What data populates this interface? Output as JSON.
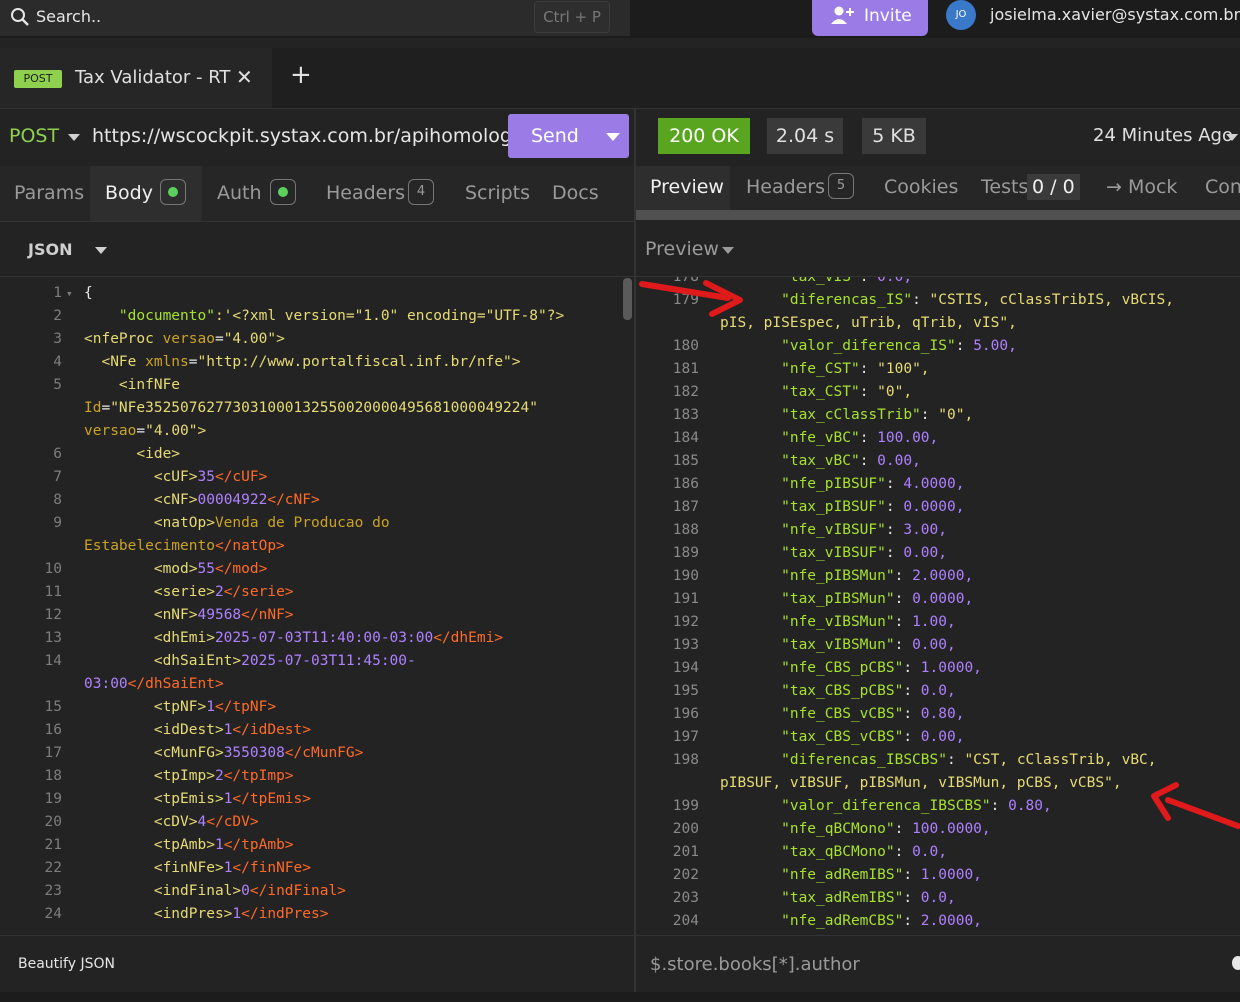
{
  "search": {
    "placeholder": "Search..",
    "shortcut": "Ctrl + P"
  },
  "invite": {
    "label": "Invite"
  },
  "user": {
    "initials": "JO",
    "email": "josielma.xavier@systax.com.br"
  },
  "tab": {
    "method": "POST",
    "name": "Tax Validator - RT",
    "close": "✕",
    "add": "+"
  },
  "request": {
    "method": "POST",
    "url": "https://wscockpit.systax.com.br/apihomologacao",
    "send_label": "Send"
  },
  "response": {
    "status": "200 OK",
    "time": "2.04 s",
    "size": "5 KB",
    "ago": "24 Minutes Ago"
  },
  "request_tabs": {
    "params": "Params",
    "body": "Body",
    "auth": "Auth",
    "headers": "Headers",
    "headers_count": "4",
    "scripts": "Scripts",
    "docs": "Docs"
  },
  "response_tabs": {
    "preview": "Preview",
    "headers": "Headers",
    "headers_count": "5",
    "cookies": "Cookies",
    "tests": "Tests",
    "tests_count": "0 / 0",
    "mock": "→ Mock",
    "console": "Con"
  },
  "body_format": "JSON",
  "preview_mode": "Preview",
  "editor": {
    "line_numbers": [
      "1",
      "2",
      "3",
      "4",
      "5",
      "6",
      "7",
      "8",
      "9",
      "10",
      "11",
      "12",
      "13",
      "14",
      "15",
      "16",
      "17",
      "18",
      "19",
      "20",
      "21",
      "22",
      "23",
      "24"
    ],
    "lines": {
      "l1": "{",
      "l2_key": "\"documento\"",
      "l2_sep": ":'<?xml version=",
      "l2_v1": "\"1.0\"",
      "l2_mid": " encoding=",
      "l2_v2": "\"UTF-8\"",
      "l2_end": "?>",
      "l3_tag": "<nfeProc",
      "l3_attr": " versao",
      "l3_eq": "=",
      "l3_val": "\"4.00\"",
      "l3_end": ">",
      "l4_tag": "  <NFe",
      "l4_attr": " xmlns",
      "l4_eq": "=",
      "l4_val": "\"http://www.portalfiscal.inf.br/nfe\"",
      "l4_end": ">",
      "l5": "    <infNFe",
      "l5b_attr": "Id",
      "l5b_eq": "=",
      "l5b_val": "\"NFe35250762773031000132550020000495681000049224\"",
      "l5c_attr": "versao",
      "l5c_eq": "=",
      "l5c_val": "\"4.00\"",
      "l5c_end": ">",
      "l6": "      <ide>",
      "l7_open": "        <cUF>",
      "l7_val": "35",
      "l7_close": "</cUF>",
      "l8_open": "        <cNF>",
      "l8_val": "00004922",
      "l8_close": "</cNF>",
      "l9_open": "        <natOp>",
      "l9_val": "Venda de Producao do",
      "l9b_val": "Estabelecimento",
      "l9b_close": "</natOp>",
      "l10_open": "        <mod>",
      "l10_val": "55",
      "l10_close": "</mod>",
      "l11_open": "        <serie>",
      "l11_val": "2",
      "l11_close": "</serie>",
      "l12_open": "        <nNF>",
      "l12_val": "49568",
      "l12_close": "</nNF>",
      "l13_open": "        <dhEmi>",
      "l13_val": "2025-07-03T11:40:00-03:00",
      "l13_close": "</dhEmi>",
      "l14_open": "        <dhSaiEnt>",
      "l14_val": "2025-07-03T11:45:00-",
      "l14b_val": "03:00",
      "l14b_close": "</dhSaiEnt>",
      "l15_open": "        <tpNF>",
      "l15_val": "1",
      "l15_close": "</tpNF>",
      "l16_open": "        <idDest>",
      "l16_val": "1",
      "l16_close": "</idDest>",
      "l17_open": "        <cMunFG>",
      "l17_val": "3550308",
      "l17_close": "</cMunFG>",
      "l18_open": "        <tpImp>",
      "l18_val": "2",
      "l18_close": "</tpImp>",
      "l19_open": "        <tpEmis>",
      "l19_val": "1",
      "l19_close": "</tpEmis>",
      "l20_open": "        <cDV>",
      "l20_val": "4",
      "l20_close": "</cDV>",
      "l21_open": "        <tpAmb>",
      "l21_val": "1",
      "l21_close": "</tpAmb>",
      "l22_open": "        <finNFe>",
      "l22_val": "1",
      "l22_close": "</finNFe>",
      "l23_open": "        <indFinal>",
      "l23_val": "0",
      "l23_close": "</indFinal>",
      "l24_open": "        <indPres>",
      "l24_val": "1",
      "l24_close": "</indPres>"
    }
  },
  "viewer": {
    "line_numbers": [
      "178",
      "179",
      "180",
      "181",
      "182",
      "183",
      "184",
      "185",
      "186",
      "187",
      "188",
      "189",
      "190",
      "191",
      "192",
      "193",
      "194",
      "195",
      "196",
      "197",
      "198",
      "199",
      "200",
      "201",
      "202",
      "203",
      "204"
    ],
    "rows": [
      {
        "key": "\"tax_vIS\"",
        "sep": ": ",
        "val": "0.0,",
        "cls": "n"
      },
      {
        "key": "\"diferencas_IS\"",
        "sep": ": ",
        "val": "\"CSTIS, cClassTribIS, vBCIS,",
        "cls": "s"
      },
      {
        "key": "\"valor_diferenca_IS\"",
        "sep": ": ",
        "val": "5.00,",
        "cls": "n"
      },
      {
        "key": "\"nfe_CST\"",
        "sep": ": ",
        "val": "\"100\",",
        "cls": "s"
      },
      {
        "key": "\"tax_CST\"",
        "sep": ": ",
        "val": "\"0\",",
        "cls": "s"
      },
      {
        "key": "\"tax_cClassTrib\"",
        "sep": ": ",
        "val": "\"0\",",
        "cls": "s"
      },
      {
        "key": "\"nfe_vBC\"",
        "sep": ": ",
        "val": "100.00,",
        "cls": "n"
      },
      {
        "key": "\"tax_vBC\"",
        "sep": ": ",
        "val": "0.00,",
        "cls": "n"
      },
      {
        "key": "\"nfe_pIBSUF\"",
        "sep": ": ",
        "val": "4.0000,",
        "cls": "n"
      },
      {
        "key": "\"tax_pIBSUF\"",
        "sep": ": ",
        "val": "0.0000,",
        "cls": "n"
      },
      {
        "key": "\"nfe_vIBSUF\"",
        "sep": ": ",
        "val": "3.00,",
        "cls": "n"
      },
      {
        "key": "\"tax_vIBSUF\"",
        "sep": ": ",
        "val": "0.00,",
        "cls": "n"
      },
      {
        "key": "\"nfe_pIBSMun\"",
        "sep": ": ",
        "val": "2.0000,",
        "cls": "n"
      },
      {
        "key": "\"tax_pIBSMun\"",
        "sep": ": ",
        "val": "0.0000,",
        "cls": "n"
      },
      {
        "key": "\"nfe_vIBSMun\"",
        "sep": ": ",
        "val": "1.00,",
        "cls": "n"
      },
      {
        "key": "\"tax_vIBSMun\"",
        "sep": ": ",
        "val": "0.00,",
        "cls": "n"
      },
      {
        "key": "\"nfe_CBS_pCBS\"",
        "sep": ": ",
        "val": "1.0000,",
        "cls": "n"
      },
      {
        "key": "\"tax_CBS_pCBS\"",
        "sep": ": ",
        "val": "0.0,",
        "cls": "n"
      },
      {
        "key": "\"nfe_CBS_vCBS\"",
        "sep": ": ",
        "val": "0.80,",
        "cls": "n"
      },
      {
        "key": "\"tax_CBS_vCBS\"",
        "sep": ": ",
        "val": "0.00,",
        "cls": "n"
      },
      {
        "key": "\"diferencas_IBSCBS\"",
        "sep": ": ",
        "val": "\"CST, cClassTrib, vBC,",
        "cls": "s"
      },
      {
        "key": "\"valor_diferenca_IBSCBS\"",
        "sep": ": ",
        "val": "0.80,",
        "cls": "n"
      },
      {
        "key": "\"nfe_qBCMono\"",
        "sep": ": ",
        "val": "100.0000,",
        "cls": "n"
      },
      {
        "key": "\"tax_qBCMono\"",
        "sep": ": ",
        "val": "0.0,",
        "cls": "n"
      },
      {
        "key": "\"nfe_adRemIBS\"",
        "sep": ": ",
        "val": "1.0000,",
        "cls": "n"
      },
      {
        "key": "\"tax_adRemIBS\"",
        "sep": ": ",
        "val": "0.0,",
        "cls": "n"
      },
      {
        "key": "\"nfe_adRemCBS\"",
        "sep": ": ",
        "val": "2.0000,",
        "cls": "n"
      }
    ],
    "wrap_179": "pIS, pISEspec, uTrib, qTrib, vIS\",",
    "wrap_198": "pIBSUF, vIBSUF, pIBSMun, vIBSMun, pCBS, vCBS\","
  },
  "footer": {
    "beautify": "Beautify JSON",
    "filter_placeholder": "$.store.books[*].author"
  },
  "colors": {
    "accent": "#9b7ce6",
    "method_post": "#8fd14f",
    "status_ok": "#5aa51f",
    "annotation_arrow": "#e0191b"
  }
}
